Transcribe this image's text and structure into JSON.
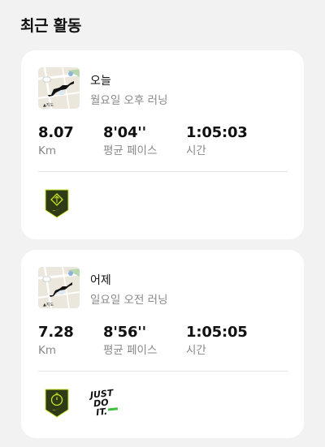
{
  "section": {
    "title": "최근 활동"
  },
  "colors": {
    "background": "#f2f2f2",
    "card": "#ffffff",
    "text_primary": "#111111",
    "text_secondary": "#888888",
    "badge_dark": "#2f3a16",
    "badge_accent": "#c8e62a"
  },
  "activities": [
    {
      "day": "오늘",
      "subtitle": "월요일 오후 러닝",
      "map_icon": "route-map-thumbnail",
      "stats": [
        {
          "value": "8.07",
          "label": "Km"
        },
        {
          "value": "8'04''",
          "label": "평균 페이스"
        },
        {
          "value": "1:05:03",
          "label": "시간"
        }
      ],
      "badges": [
        "diamond-shield-badge-icon"
      ]
    },
    {
      "day": "어제",
      "subtitle": "일요일 오전 러닝",
      "map_icon": "route-map-thumbnail",
      "stats": [
        {
          "value": "7.28",
          "label": "Km"
        },
        {
          "value": "8'56''",
          "label": "평균 페이스"
        },
        {
          "value": "1:05:05",
          "label": "시간"
        }
      ],
      "badges": [
        "stopwatch-shield-badge-icon",
        "just-do-it-badge-icon"
      ],
      "badge_text": "JUST DO IT."
    }
  ]
}
